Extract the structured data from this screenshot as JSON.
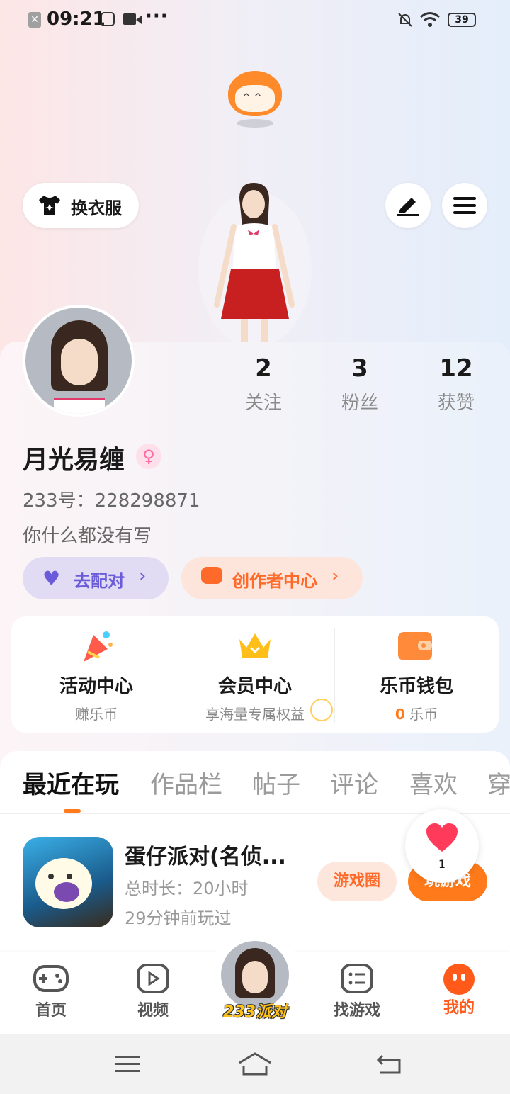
{
  "status": {
    "time": "09:21",
    "dots": "···",
    "battery": "39"
  },
  "header": {
    "outfit_label": "换衣服"
  },
  "profile": {
    "name": "月光易缠",
    "id_line": "233号：228298871",
    "bio": "你什么都没有写",
    "stats": [
      {
        "num": "2",
        "label": "关注"
      },
      {
        "num": "3",
        "label": "粉丝"
      },
      {
        "num": "12",
        "label": "获赞"
      }
    ],
    "match_label": "去配对",
    "creator_label": "创作者中心"
  },
  "features": [
    {
      "title": "活动中心",
      "sub": "赚乐币"
    },
    {
      "title": "会员中心",
      "sub": "享海量专属权益"
    },
    {
      "title": "乐币钱包",
      "sub_num": "0",
      "sub": "乐币"
    }
  ],
  "tabs": [
    "最近在玩",
    "作品栏",
    "帖子",
    "评论",
    "喜欢",
    "穿"
  ],
  "game": {
    "title": "蛋仔派对(名侦...",
    "duration": "总时长：20小时",
    "last_played": "29分钟前玩过",
    "circle_button": "游戏圈",
    "play_button": "玩游戏",
    "like_count": "1"
  },
  "bottom_nav": {
    "home": "首页",
    "video": "视频",
    "center_logo": "233派对",
    "find": "找游戏",
    "mine": "我的"
  },
  "colors": {
    "accent": "#ff7a1a",
    "purple": "#6a5cd8",
    "female": "#ff6aa0"
  }
}
